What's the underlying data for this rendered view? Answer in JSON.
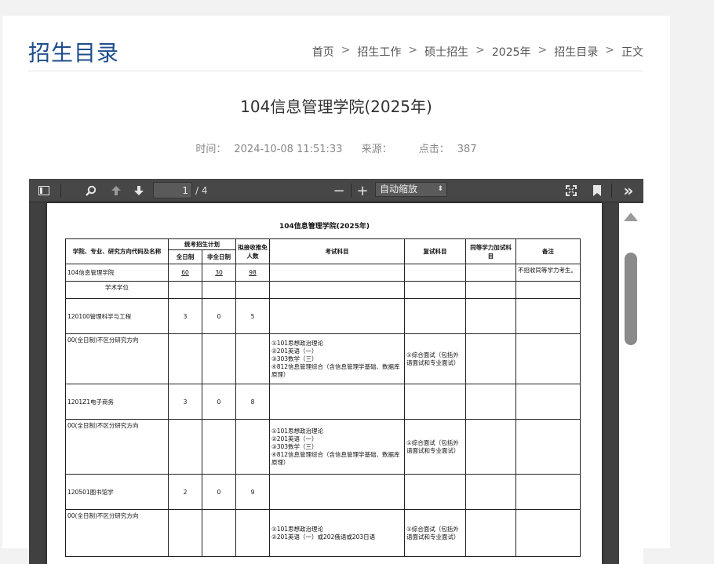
{
  "header": {
    "section_title": "招生目录",
    "breadcrumb": [
      "首页",
      "招生工作",
      "硕士招生",
      "2025年",
      "招生目录",
      "正文"
    ],
    "separator": ">"
  },
  "article": {
    "title": "104信息管理学院(2025年)",
    "time_label": "时间：",
    "time_value": "2024-10-08 11:51:33",
    "source_label": "来源：",
    "source_value": "",
    "clicks_label": "点击：",
    "clicks_value": "387"
  },
  "viewer": {
    "page_current": "1",
    "page_total": "/ 4",
    "zoom": "自动缩放",
    "icons": [
      "sidebar-toggle-icon",
      "search-icon",
      "previous-page-icon",
      "next-page-icon",
      "zoom-out-icon",
      "zoom-in-icon",
      "presentation-mode-icon",
      "bookmark-icon",
      "tools-icon"
    ],
    "zoom_out_glyph": "−",
    "zoom_in_glyph": "+",
    "tools_glyph": "»"
  },
  "document": {
    "title": "104信息管理学院(2025年)",
    "headers": {
      "col1": "学院、专业、研究方向代码及名称",
      "plan": "统考招生计划",
      "full_time": "全日制",
      "part_time": "非全日制",
      "exempt": "拟接收推免人数",
      "exam": "考试科目",
      "retest": "复试科目",
      "equivalent": "同等学力加试科目",
      "remark": "备注"
    },
    "rows": [
      {
        "name": "104信息管理学院",
        "full": "60",
        "part": "30",
        "exempt": "98",
        "exam": "",
        "retest": "",
        "equiv": "",
        "remark": "不招收同等学力考生。",
        "underline": true
      },
      {
        "name": "学术学位",
        "full": "",
        "part": "",
        "exempt": "",
        "exam": "",
        "retest": "",
        "equiv": "",
        "remark": "",
        "section": true
      },
      {
        "name": "120100管理科学与工程",
        "full": "3",
        "part": "0",
        "exempt": "5",
        "exam": "",
        "retest": "",
        "equiv": "",
        "remark": ""
      },
      {
        "name": "00(全日制)不区分研究方向",
        "full": "",
        "part": "",
        "exempt": "",
        "exam": "①101思想政治理论\n②201英语（一）\n③303数学（三）\n④812信息管理综合（含信息管理学基础、数据库原理）",
        "retest": "①综合面试（包括外语面试和专业面试）",
        "equiv": "",
        "remark": ""
      },
      {
        "name": "1201Z1电子商务",
        "full": "3",
        "part": "0",
        "exempt": "8",
        "exam": "",
        "retest": "",
        "equiv": "",
        "remark": ""
      },
      {
        "name": "00(全日制)不区分研究方向",
        "full": "",
        "part": "",
        "exempt": "",
        "exam": "①101思想政治理论\n②201英语（一）\n③303数学（三）\n④812信息管理综合（含信息管理学基础、数据库原理）",
        "retest": "①综合面试（包括外语面试和专业面试）",
        "equiv": "",
        "remark": ""
      },
      {
        "name": "120501图书馆学",
        "full": "2",
        "part": "0",
        "exempt": "9",
        "exam": "",
        "retest": "",
        "equiv": "",
        "remark": ""
      },
      {
        "name": "00(全日制)不区分研究方向",
        "full": "",
        "part": "",
        "exempt": "",
        "exam": "①101思想政治理论\n②201英语（一）或202俄语或203日语",
        "retest": "①综合面试（包括外语面试和专业面试）",
        "equiv": "",
        "remark": ""
      }
    ]
  }
}
